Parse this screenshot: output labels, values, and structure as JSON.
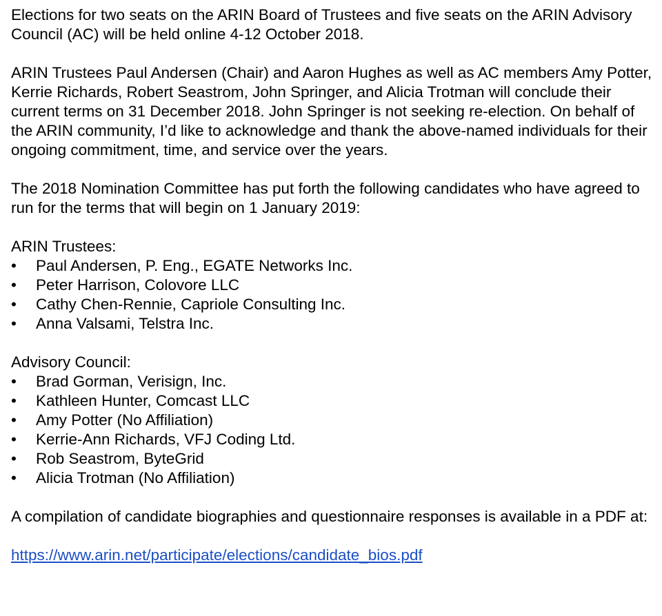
{
  "paragraphs": {
    "intro": "Elections for two seats on the ARIN Board of Trustees and five seats on the ARIN Advisory Council (AC) will be held online 4-12 October 2018.",
    "terms": "ARIN Trustees Paul Andersen (Chair) and Aaron Hughes as well as AC members Amy Potter, Kerrie Richards, Robert Seastrom, John Springer, and Alicia Trotman will conclude their current terms on 31 December 2018. John Springer is not seeking re-election. On behalf of the ARIN community, I’d like to acknowledge and thank the above-named individuals for their ongoing commitment, time, and service over the years.",
    "nomination": "The 2018 Nomination Committee has put forth the following candidates who have agreed to run for the terms that will begin on 1 January 2019:",
    "compilation": "A compilation of candidate biographies and questionnaire responses is available in a PDF at:"
  },
  "bullet_char": "•",
  "trustees": {
    "title": "ARIN Trustees:",
    "items": [
      "Paul Andersen, P. Eng., EGATE Networks Inc.",
      "Peter Harrison, Colovore LLC",
      "Cathy Chen-Rennie, Capriole Consulting Inc.",
      "Anna Valsami, Telstra Inc."
    ]
  },
  "council": {
    "title": "Advisory Council:",
    "items": [
      "Brad Gorman, Verisign, Inc.",
      "Kathleen Hunter, Comcast LLC",
      "Amy Potter (No Affiliation)",
      "Kerrie-Ann Richards, VFJ Coding Ltd.",
      "Rob Seastrom, ByteGrid",
      "Alicia Trotman (No Affiliation)"
    ]
  },
  "link": {
    "text": "https://www.arin.net/participate/elections/candidate_bios.pdf",
    "href": "https://www.arin.net/participate/elections/candidate_bios.pdf",
    "color": "#1a4fc4"
  }
}
